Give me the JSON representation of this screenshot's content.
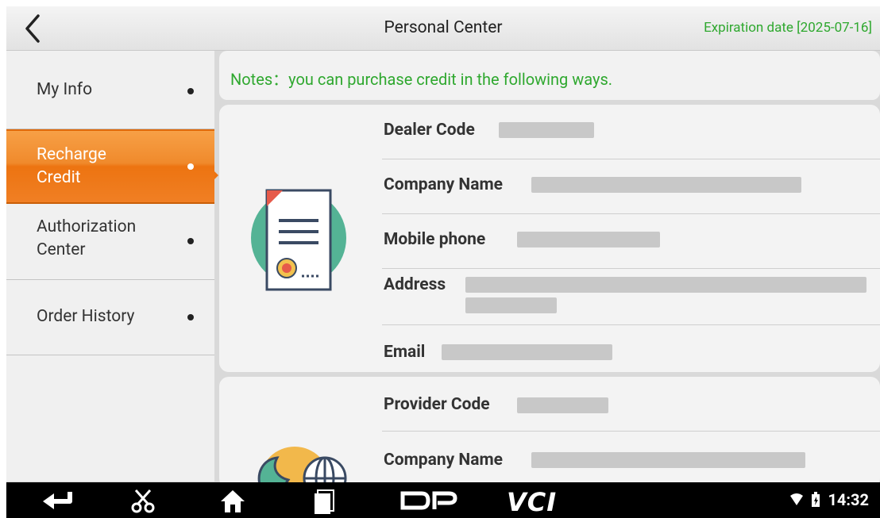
{
  "header": {
    "title": "Personal Center",
    "expiration": "Expiration date [2025-07-16]"
  },
  "sidebar": {
    "items": [
      {
        "label": "My Info"
      },
      {
        "label": "Recharge\nCredit"
      },
      {
        "label": "Authorization\nCenter"
      },
      {
        "label": "Order History"
      }
    ]
  },
  "notes": "Notes：you can purchase credit in the following ways.",
  "dealer_card": {
    "rows": [
      "Dealer Code",
      "Company Name",
      "Mobile phone",
      "Address",
      "Email"
    ]
  },
  "provider_card": {
    "rows": [
      "Provider Code",
      "Company Name"
    ]
  },
  "navbar": {
    "dp_label": "DP",
    "vci_label": "VCI",
    "time": "14:32"
  },
  "colors": {
    "accent_orange": "#ed7411",
    "green_text": "#2fa82f"
  }
}
